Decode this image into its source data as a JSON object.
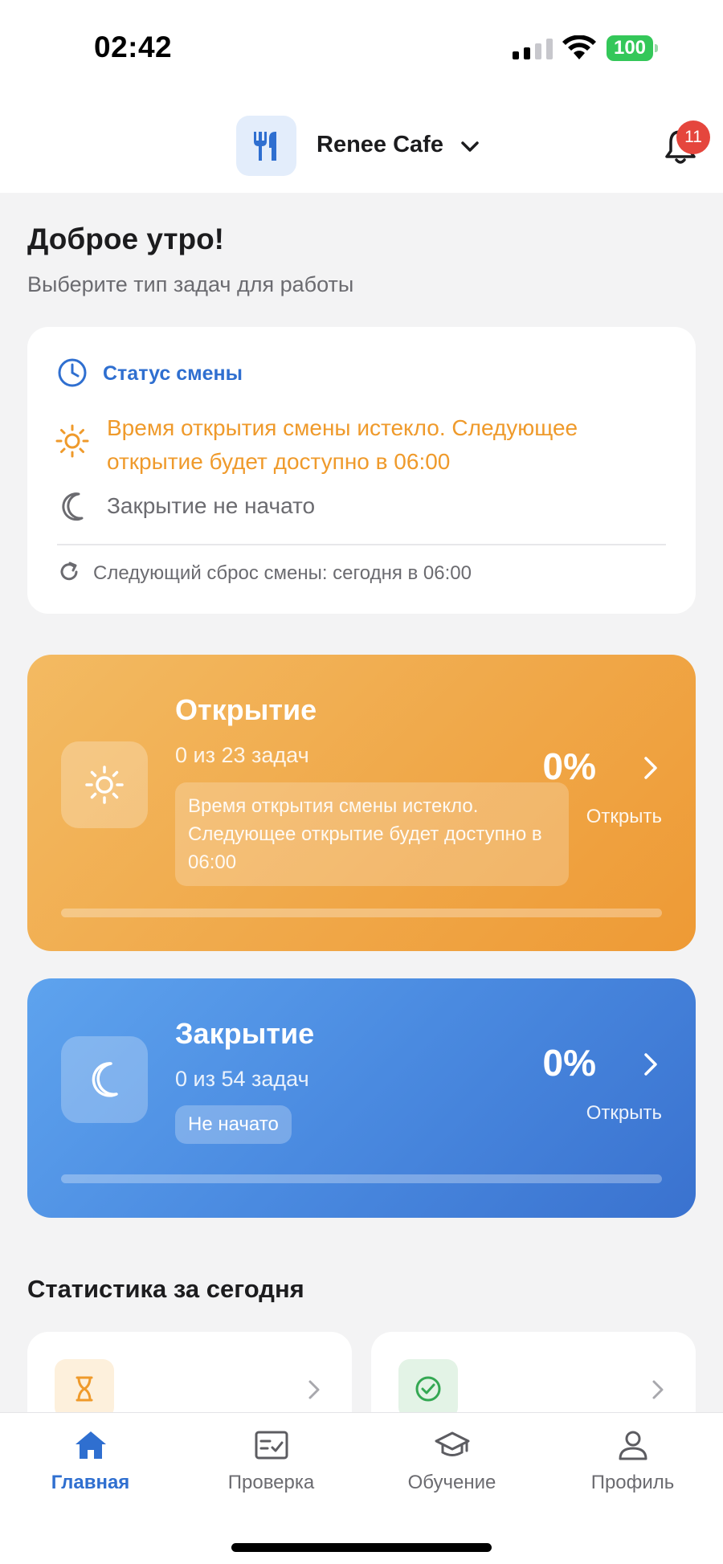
{
  "status_bar": {
    "time": "02:42",
    "battery": "100",
    "signal_icon": "cellular-signal-icon",
    "wifi_icon": "wifi-icon"
  },
  "header": {
    "logo_icon": "fork-knife-icon",
    "cafe_name": "Renee Cafe",
    "dropdown_icon": "chevron-down-icon",
    "bell_icon": "bell-icon",
    "notifications_count": "11"
  },
  "greeting": {
    "title": "Доброе утро!",
    "subtitle": "Выберите тип задач для работы"
  },
  "status_card": {
    "title": "Статус смены",
    "opening_status": "Время открытия смены истекло. Следующее открытие будет доступно в 06:00",
    "closing_status": "Закрытие не начато",
    "reset_info": "Следующий сброс смены: сегодня в 06:00"
  },
  "shifts": {
    "opening": {
      "title": "Открытие",
      "count": "0 из 23 задач",
      "note": "Время открытия смены истекло. Следующее открытие будет доступно в 06:00",
      "percent": "0%",
      "progress": 0,
      "action": "Открыть",
      "icon": "sun-icon"
    },
    "closing": {
      "title": "Закрытие",
      "count": "0 из 54 задач",
      "badge": "Не начато",
      "percent": "0%",
      "progress": 0,
      "action": "Открыть",
      "icon": "moon-icon"
    }
  },
  "stats": {
    "title": "Статистика за сегодня",
    "cards": [
      {
        "icon": "hourglass-icon"
      },
      {
        "icon": "check-circle-icon"
      }
    ]
  },
  "tabbar": {
    "tabs": [
      {
        "label": "Главная",
        "icon": "home-icon",
        "active": true
      },
      {
        "label": "Проверка",
        "icon": "checklist-icon",
        "active": false
      },
      {
        "label": "Обучение",
        "icon": "graduation-cap-icon",
        "active": false
      },
      {
        "label": "Профиль",
        "icon": "user-icon",
        "active": false
      }
    ]
  },
  "colors": {
    "accent": "#2f6fd0",
    "warning": "#ef9a2b",
    "opening_gradient": "#f0a849",
    "closing_gradient": "#4a8ae0",
    "badge": "#e5463d"
  }
}
